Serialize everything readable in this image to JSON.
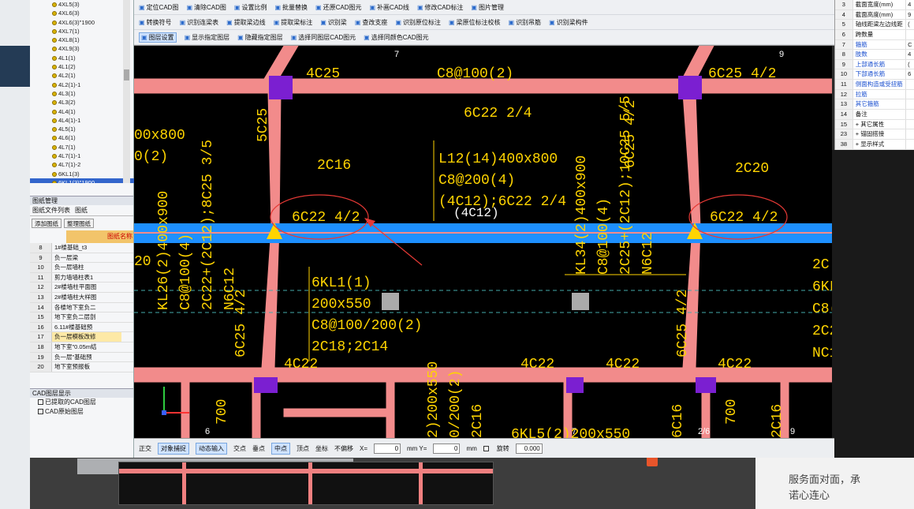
{
  "left_tree": {
    "items": [
      "4XL5(3)",
      "4XL6(3)",
      "4XL6(3)\"1900",
      "4XL7(1)",
      "4XL8(1)",
      "4XL9(3)",
      "4L1(1)",
      "4L1(2)",
      "4L2(1)",
      "4L2(1)-1",
      "4L3(1)",
      "4L3(2)",
      "4L4(1)",
      "4L4(1)-1",
      "4L5(1)",
      "4L6(1)",
      "4L7(1)",
      "4L7(1)-1",
      "4L7(1)-2",
      "6KL1(3)",
      "6KL1(3)\"1900",
      "6KL1(4)"
    ],
    "selected_index": 20
  },
  "drawings": {
    "title": "图纸管理",
    "tabs": [
      "图纸文件列表",
      "图纸"
    ],
    "add_label": "添加图纸",
    "edit_label": "整理图纸",
    "col_header": "图纸名称",
    "rows": [
      {
        "n": "8",
        "name": "1#楼基础_t3"
      },
      {
        "n": "9",
        "name": "负一层梁"
      },
      {
        "n": "10",
        "name": "负一层墙柱"
      },
      {
        "n": "11",
        "name": "剪力墙墙柱表1"
      },
      {
        "n": "12",
        "name": "2#楼墙柱平面图"
      },
      {
        "n": "13",
        "name": "2#楼墙柱大样图"
      },
      {
        "n": "14",
        "name": "各楼地下室负二"
      },
      {
        "n": "15",
        "name": "地下室负二层剖"
      },
      {
        "n": "16",
        "name": "6.11#楼基础预"
      },
      {
        "n": "17",
        "name": "负一层模板改修"
      },
      {
        "n": "18",
        "name": "地下室\"0.05m结"
      },
      {
        "n": "19",
        "name": "负一层\"基础预"
      },
      {
        "n": "20",
        "name": "地下室预报板"
      }
    ],
    "selected_row": 9
  },
  "layers": {
    "title": "CAD图层显示",
    "items": [
      "已提取的CAD图层",
      "CAD原始图层"
    ]
  },
  "toolbar": {
    "row1": [
      "定位CAD图",
      "清除CAD图",
      "设置比例",
      "批量替换",
      "还原CAD图元",
      "补画CAD线",
      "修改CAD标注",
      "图片管理"
    ],
    "row2": [
      "转换符号",
      "识别连梁表",
      "提取梁边线",
      "提取梁标注",
      "识别梁",
      "查改支座",
      "识别原位标注",
      "梁原位标注校核",
      "识别吊筋",
      "识别梁构件"
    ],
    "row3": [
      "图层设置",
      "显示指定图层",
      "隐藏指定图层",
      "选择同图层CAD图元",
      "选择同颜色CAD图元"
    ]
  },
  "properties": {
    "rows": [
      {
        "n": "3",
        "k": "截面宽度(mm)",
        "v": "4",
        "blue": false
      },
      {
        "n": "4",
        "k": "截面高度(mm)",
        "v": "9",
        "blue": false
      },
      {
        "n": "5",
        "k": "轴线距梁左边线距",
        "v": "(",
        "blue": false
      },
      {
        "n": "6",
        "k": "跨数量",
        "v": "",
        "blue": false
      },
      {
        "n": "7",
        "k": "箍筋",
        "v": "C",
        "blue": true
      },
      {
        "n": "8",
        "k": "肢数",
        "v": "4",
        "blue": true
      },
      {
        "n": "9",
        "k": "上部通长筋",
        "v": "(",
        "blue": true
      },
      {
        "n": "10",
        "k": "下部通长筋",
        "v": "6",
        "blue": true
      },
      {
        "n": "11",
        "k": "侧面构造或受扭筋",
        "v": "",
        "blue": true
      },
      {
        "n": "12",
        "k": "拉筋",
        "v": "",
        "blue": true
      },
      {
        "n": "13",
        "k": "其它箍筋",
        "v": "",
        "blue": true
      },
      {
        "n": "14",
        "k": "备注",
        "v": "",
        "blue": false
      },
      {
        "n": "15",
        "k": "+ 其它属性",
        "v": "",
        "blue": false
      },
      {
        "n": "23",
        "k": "+ 锚固搭接",
        "v": "",
        "blue": false
      },
      {
        "n": "38",
        "k": "+ 显示样式",
        "v": "",
        "blue": false
      }
    ]
  },
  "cad": {
    "axis_labels": [
      "7",
      "9",
      "6",
      "7",
      "9",
      "2/6"
    ],
    "texts": {
      "t_4c25_a": "4C25",
      "t_c8_100": "C8@100(2)",
      "t_6c25_42_top": "6C25 4/2",
      "t_6c22_24": "6C22 2/4",
      "t_5c25_top": "5C25",
      "t_5c25": "5C25",
      "t_00x800": "00x800",
      "t_0_2": "0(2)",
      "t_2c16": "2C16",
      "t_l12_a": "L12(14)400x800",
      "t_l12_b": "C8@200(4)",
      "t_l12_c": "(4C12);6C22 2/4",
      "t_4c12": "(4C12)",
      "t_6c25_42_v": "6C25 4/2",
      "t_2c20": "2C20",
      "t_6c22_42_left": "6C22 4/2",
      "t_6c22_42_right": "6C22 4/2",
      "t_2_left": "2)",
      "t_20_left": "20",
      "t_kl26": "KL26(2)400x900",
      "t_kl26_b": "C8@100(4)",
      "t_kl26_c": "2C22+(2C12);8C25 3/5",
      "t_kl26_d": "N6C12",
      "t_6c25_42_left_v": "6C25 4/2",
      "t_6kl1_a": "6KL1(1)",
      "t_6kl1_b": "200x550",
      "t_6kl1_c": "C8@100/200(2)",
      "t_6kl1_d": "2C18;2C14",
      "t_kl34_a": "KL34(2)400x900",
      "t_kl34_b": "C8@100(4)",
      "t_kl34_c": "2C25+(2C12);10C25 5/5",
      "t_kl34_d": "N6C12",
      "t_6c25_42_r2": "6C25 4/2",
      "t_4c22_a": "4C22",
      "t_4c22_b": "4C22",
      "t_4c22_c": "4C22",
      "t_4c22_d": "4C22",
      "t_right_2c": "2C",
      "t_right_6k": "6KL",
      "t_right_c8": "C8(",
      "t_right_2c2": "2C2",
      "t_right_nc": "NC1",
      "t_700_a": "700",
      "t_700_b": "700",
      "t_200x550": "2)200x550",
      "t_0_200": "0/200(2)",
      "t_2c16_b": "2C16",
      "t_2c16_c": "2C16",
      "t_6kl5": "6KL5(2)200x550",
      "t_6c16": "6C16"
    }
  },
  "statusbar": {
    "items": [
      "正交",
      "对象捕捉",
      "动态输入",
      "交点",
      "垂点",
      "中点",
      "顶点",
      "坐标",
      "不偏移"
    ],
    "x_label": "X=",
    "x_val": "0",
    "y_label": "mm Y=",
    "y_val": "0",
    "unit": "mm",
    "rot_label": "旋转",
    "rot_val": "0.000"
  },
  "right_promo": {
    "line1": "服务面对面，承",
    "line2": "诺心连心"
  }
}
